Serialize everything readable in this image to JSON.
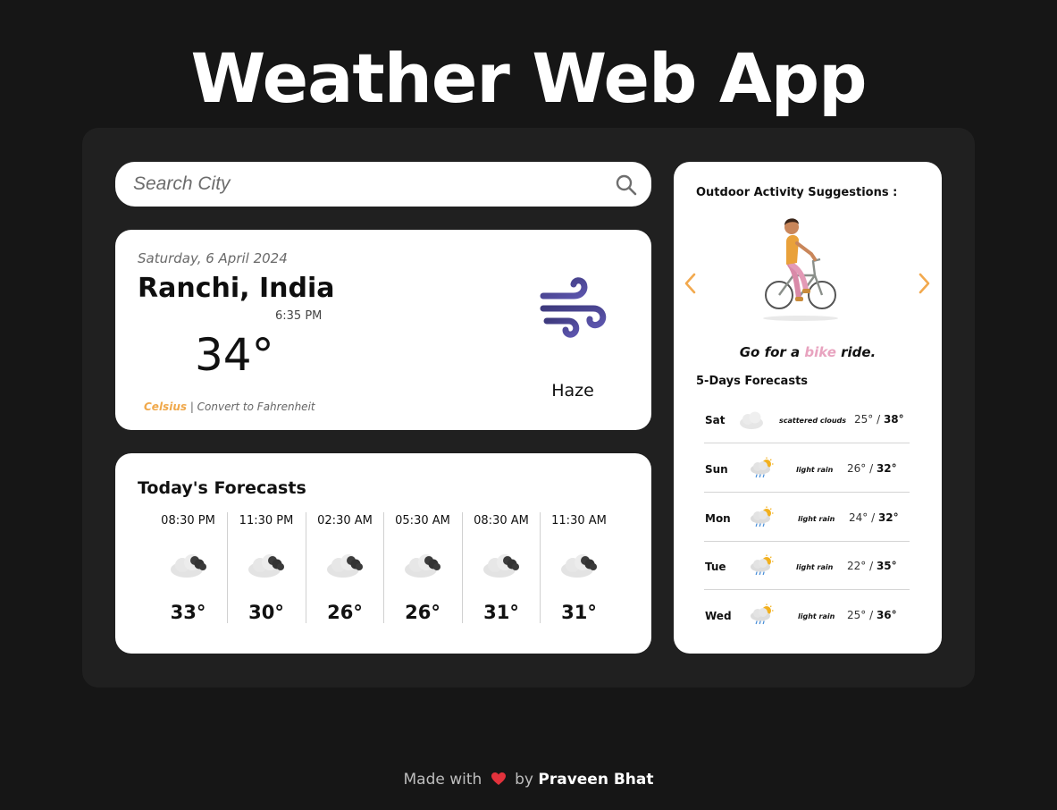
{
  "app": {
    "title": "Weather Web App"
  },
  "search": {
    "placeholder": "Search City"
  },
  "current": {
    "date": "Saturday, 6 April 2024",
    "location": "Ranchi, India",
    "time": "6:35 PM",
    "temperature": "34°",
    "condition": "Haze",
    "icon": "wind-icon",
    "unit_active": "Celsius",
    "unit_separator": " | ",
    "unit_convert": "Convert to Fahrenheit"
  },
  "today": {
    "title": "Today's Forecasts",
    "hours": [
      {
        "time": "08:30 PM",
        "temp": "33°",
        "icon": "cloudy-icon"
      },
      {
        "time": "11:30 PM",
        "temp": "30°",
        "icon": "cloudy-icon"
      },
      {
        "time": "02:30 AM",
        "temp": "26°",
        "icon": "cloudy-icon"
      },
      {
        "time": "05:30 AM",
        "temp": "26°",
        "icon": "cloudy-icon"
      },
      {
        "time": "08:30 AM",
        "temp": "31°",
        "icon": "cloudy-icon"
      },
      {
        "time": "11:30 AM",
        "temp": "31°",
        "icon": "cloudy-icon"
      }
    ]
  },
  "activity": {
    "title": "Outdoor Activity Suggestions :",
    "caption_prefix": "Go for a ",
    "caption_highlight": "bike",
    "caption_suffix": " ride.",
    "image": "cyclist-illustration"
  },
  "five_day": {
    "title": "5-Days Forecasts",
    "days": [
      {
        "day": "Sat",
        "desc": "scattered clouds",
        "min": "25°",
        "sep": " / ",
        "max": "38°",
        "icon": "scattered-clouds-icon"
      },
      {
        "day": "Sun",
        "desc": "light rain",
        "min": "26°",
        "sep": " / ",
        "max": "32°",
        "icon": "light-rain-icon"
      },
      {
        "day": "Mon",
        "desc": "light rain",
        "min": "24°",
        "sep": " / ",
        "max": "32°",
        "icon": "light-rain-icon"
      },
      {
        "day": "Tue",
        "desc": "light rain",
        "min": "22°",
        "sep": " / ",
        "max": "35°",
        "icon": "light-rain-icon"
      },
      {
        "day": "Wed",
        "desc": "light rain",
        "min": "25°",
        "sep": " / ",
        "max": "36°",
        "icon": "light-rain-icon"
      }
    ]
  },
  "footer": {
    "prefix": "Made with",
    "by": "by",
    "author": "Praveen Bhat"
  },
  "colors": {
    "background": "#161616",
    "panel": "#202020",
    "accent": "#f0a84a",
    "highlight": "#e8a3bf",
    "wind": "#4b4496"
  }
}
